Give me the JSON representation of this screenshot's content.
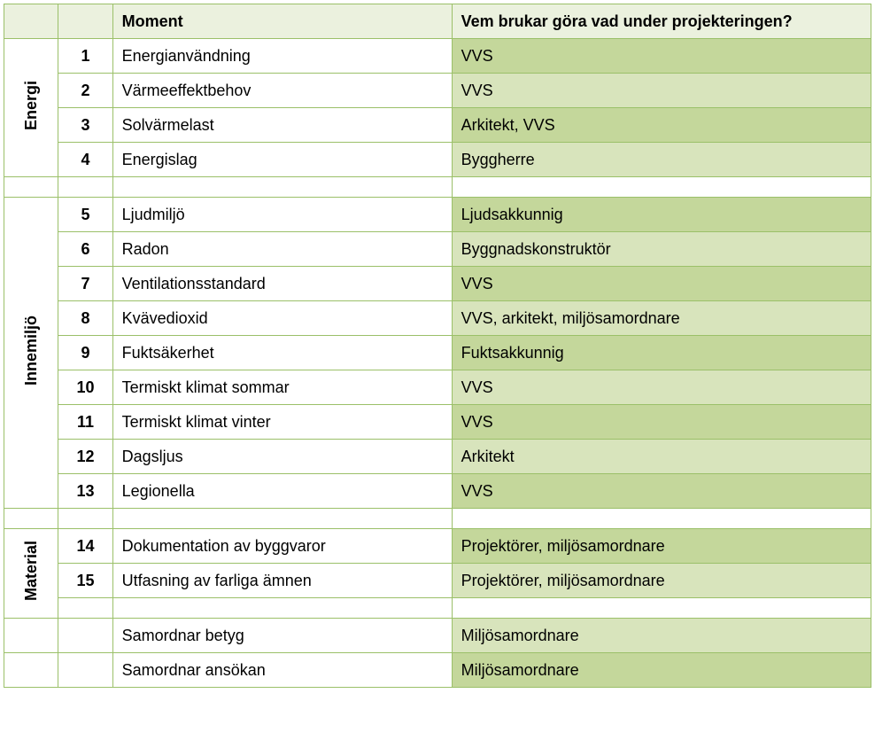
{
  "chart_data": {
    "type": "table",
    "columns": [
      "Category",
      "Num",
      "Moment",
      "Vem brukar göra vad under projekteringen?"
    ],
    "rows": [
      [
        "Energi",
        "1",
        "Energianvändning",
        "VVS"
      ],
      [
        "Energi",
        "2",
        "Värmeeffektbehov",
        "VVS"
      ],
      [
        "Energi",
        "3",
        "Solvärmelast",
        "Arkitekt, VVS"
      ],
      [
        "Energi",
        "4",
        "Energislag",
        "Byggherre"
      ],
      [
        "Innemiljö",
        "5",
        "Ljudmiljö",
        "Ljudsakkunnig"
      ],
      [
        "Innemiljö",
        "6",
        "Radon",
        "Byggnadskonstruktör"
      ],
      [
        "Innemiljö",
        "7",
        "Ventilationsstandard",
        "VVS"
      ],
      [
        "Innemiljö",
        "8",
        "Kvävedioxid",
        "VVS, arkitekt,  miljösamordnare"
      ],
      [
        "Innemiljö",
        "9",
        "Fuktsäkerhet",
        "Fuktsakkunnig"
      ],
      [
        "Innemiljö",
        "10",
        "Termiskt klimat sommar",
        "VVS"
      ],
      [
        "Innemiljö",
        "11",
        "Termiskt klimat vinter",
        "VVS"
      ],
      [
        "Innemiljö",
        "12",
        "Dagsljus",
        "Arkitekt"
      ],
      [
        "Innemiljö",
        "13",
        "Legionella",
        "VVS"
      ],
      [
        "Material",
        "14",
        "Dokumentation av byggvaror",
        "Projektörer, miljösamordnare"
      ],
      [
        "Material",
        "15",
        "Utfasning av farliga ämnen",
        "Projektörer, miljösamordnare"
      ],
      [
        "",
        "",
        "Samordnar betyg",
        "Miljösamordnare"
      ],
      [
        "",
        "",
        "Samordnar ansökan",
        "Miljösamordnare"
      ]
    ]
  },
  "headers": {
    "moment": "Moment",
    "who": "Vem brukar göra vad under projekteringen?"
  },
  "categories": {
    "energi": "Energi",
    "innemiljo": "Innemiljö",
    "material": "Material"
  },
  "rows": {
    "r1": {
      "num": "1",
      "moment": "Energianvändning",
      "who": "VVS"
    },
    "r2": {
      "num": "2",
      "moment": "Värmeeffektbehov",
      "who": "VVS"
    },
    "r3": {
      "num": "3",
      "moment": "Solvärmelast",
      "who": "Arkitekt, VVS"
    },
    "r4": {
      "num": "4",
      "moment": "Energislag",
      "who": "Byggherre"
    },
    "r5": {
      "num": "5",
      "moment": "Ljudmiljö",
      "who": "Ljudsakkunnig"
    },
    "r6": {
      "num": "6",
      "moment": "Radon",
      "who": "Byggnadskonstruktör"
    },
    "r7": {
      "num": "7",
      "moment": "Ventilationsstandard",
      "who": "VVS"
    },
    "r8": {
      "num": "8",
      "moment": "Kvävedioxid",
      "who": "VVS, arkitekt,  miljösamordnare"
    },
    "r9": {
      "num": "9",
      "moment": "Fuktsäkerhet",
      "who": "Fuktsakkunnig"
    },
    "r10": {
      "num": "10",
      "moment": "Termiskt klimat sommar",
      "who": "VVS"
    },
    "r11": {
      "num": "11",
      "moment": "Termiskt klimat vinter",
      "who": "VVS"
    },
    "r12": {
      "num": "12",
      "moment": "Dagsljus",
      "who": "Arkitekt"
    },
    "r13": {
      "num": "13",
      "moment": "Legionella",
      "who": "VVS"
    },
    "r14": {
      "num": "14",
      "moment": "Dokumentation av byggvaror",
      "who": "Projektörer, miljösamordnare"
    },
    "r15": {
      "num": "15",
      "moment": "Utfasning av farliga ämnen",
      "who": "Projektörer, miljösamordnare"
    },
    "r16": {
      "moment": "Samordnar betyg",
      "who": "Miljösamordnare"
    },
    "r17": {
      "moment": "Samordnar ansökan",
      "who": "Miljösamordnare"
    }
  }
}
